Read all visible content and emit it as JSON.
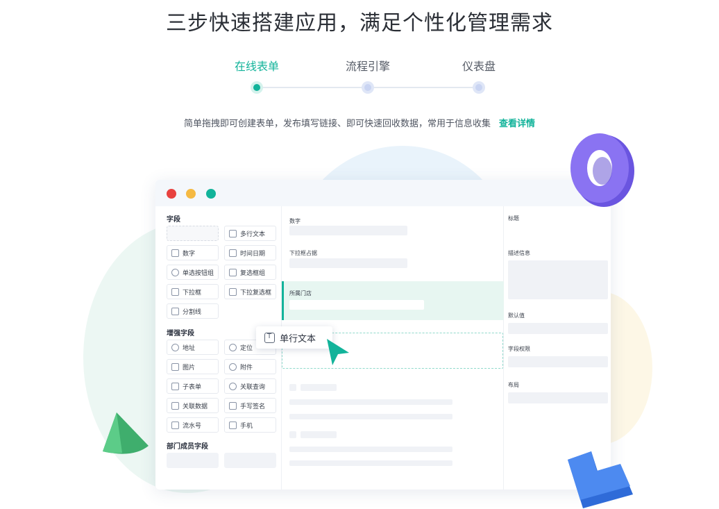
{
  "headline": "三步快速搭建应用，满足个性化管理需求",
  "steps": [
    {
      "label": "在线表单",
      "active": true
    },
    {
      "label": "流程引擎",
      "active": false
    },
    {
      "label": "仪表盘",
      "active": false
    }
  ],
  "description": "简单拖拽即可创建表单，发布填写链接、即可快速回收数据，常用于信息收集",
  "detail_link": "查看详情",
  "colors": {
    "accent": "#12b39a",
    "traffic_red": "#e8423f",
    "traffic_yellow": "#f5b942",
    "traffic_green": "#12b39a"
  },
  "left_panel": {
    "section_fields": "字段",
    "fields": [
      "多行文本",
      "数字",
      "时间日期",
      "单选按钮组",
      "复选框组",
      "下拉框",
      "下拉复选框",
      "分割线"
    ],
    "section_enhanced": "增强字段",
    "enhanced": [
      "地址",
      "定位",
      "图片",
      "附件",
      "子表单",
      "关联查询",
      "关联数据",
      "手写签名",
      "流水号",
      "手机"
    ],
    "section_dept": "部门成员字段"
  },
  "mid_panel": {
    "label_number": "数字",
    "label_dropdown": "下拉框占据",
    "label_store": "所属门店"
  },
  "right_panel": {
    "title": "标题",
    "desc_info": "描述信息",
    "default_value": "默认值",
    "field_permission": "字段权限",
    "layout": "布局"
  },
  "drag_chip": {
    "label": "单行文本",
    "icon": "text-field-icon"
  }
}
